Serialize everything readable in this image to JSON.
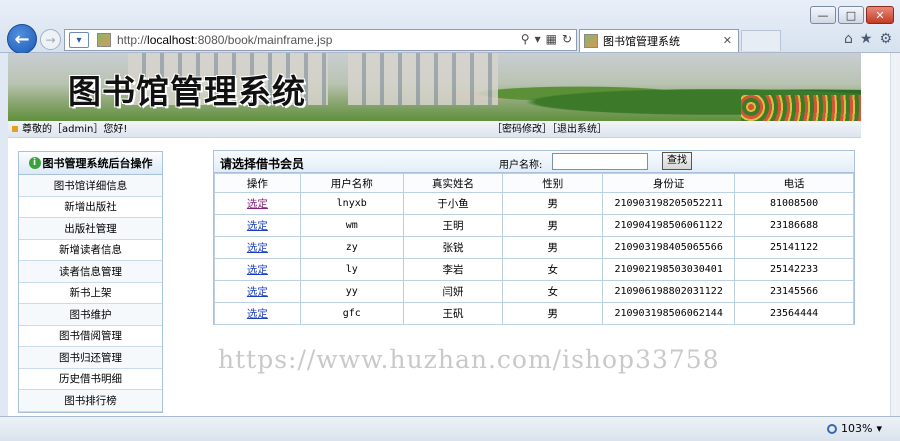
{
  "browser": {
    "url_prefix": "http://",
    "url_host": "localhost",
    "url_rest": ":8080/book/mainframe.jsp",
    "tab_title": "图书馆管理系统",
    "zoom": "103%"
  },
  "banner": {
    "title": "图书馆管理系统"
  },
  "userbar": {
    "greeting": "尊敬的［admin］您好!",
    "links": "［密码修改］［退出系统］"
  },
  "sidebar": {
    "heading": "图书管理系统后台操作",
    "items": [
      {
        "label": "图书馆详细信息"
      },
      {
        "label": "新增出版社"
      },
      {
        "label": "出版社管理"
      },
      {
        "label": "新增读者信息"
      },
      {
        "label": "读者信息管理"
      },
      {
        "label": "新书上架"
      },
      {
        "label": "图书维护"
      },
      {
        "label": "图书借阅管理"
      },
      {
        "label": "图书归还管理"
      },
      {
        "label": "历史借书明细"
      },
      {
        "label": "图书排行榜"
      }
    ]
  },
  "member_panel": {
    "title": "请选择借书会员",
    "search_label": "用户名称:",
    "search_value": "",
    "search_button": "查找",
    "columns": [
      "操作",
      "用户名称",
      "真实姓名",
      "性别",
      "身份证",
      "电话"
    ],
    "rows": [
      {
        "action": "选定",
        "username": "lnyxb",
        "realname": "于小鱼",
        "gender": "男",
        "idcard": "210903198205052211",
        "phone": "81008500",
        "visited": true
      },
      {
        "action": "选定",
        "username": "wm",
        "realname": "王明",
        "gender": "男",
        "idcard": "210904198506061122",
        "phone": "23186688",
        "visited": false
      },
      {
        "action": "选定",
        "username": "zy",
        "realname": "张锐",
        "gender": "男",
        "idcard": "210903198405065566",
        "phone": "25141122",
        "visited": false
      },
      {
        "action": "选定",
        "username": "ly",
        "realname": "李岩",
        "gender": "女",
        "idcard": "210902198503030401",
        "phone": "25142233",
        "visited": false
      },
      {
        "action": "选定",
        "username": "yy",
        "realname": "闫妍",
        "gender": "女",
        "idcard": "210906198802031122",
        "phone": "23145566",
        "visited": false
      },
      {
        "action": "选定",
        "username": "gfc",
        "realname": "王矾",
        "gender": "男",
        "idcard": "210903198506062144",
        "phone": "23564444",
        "visited": false
      }
    ]
  },
  "watermark": "https://www.huzhan.com/ishop33758"
}
